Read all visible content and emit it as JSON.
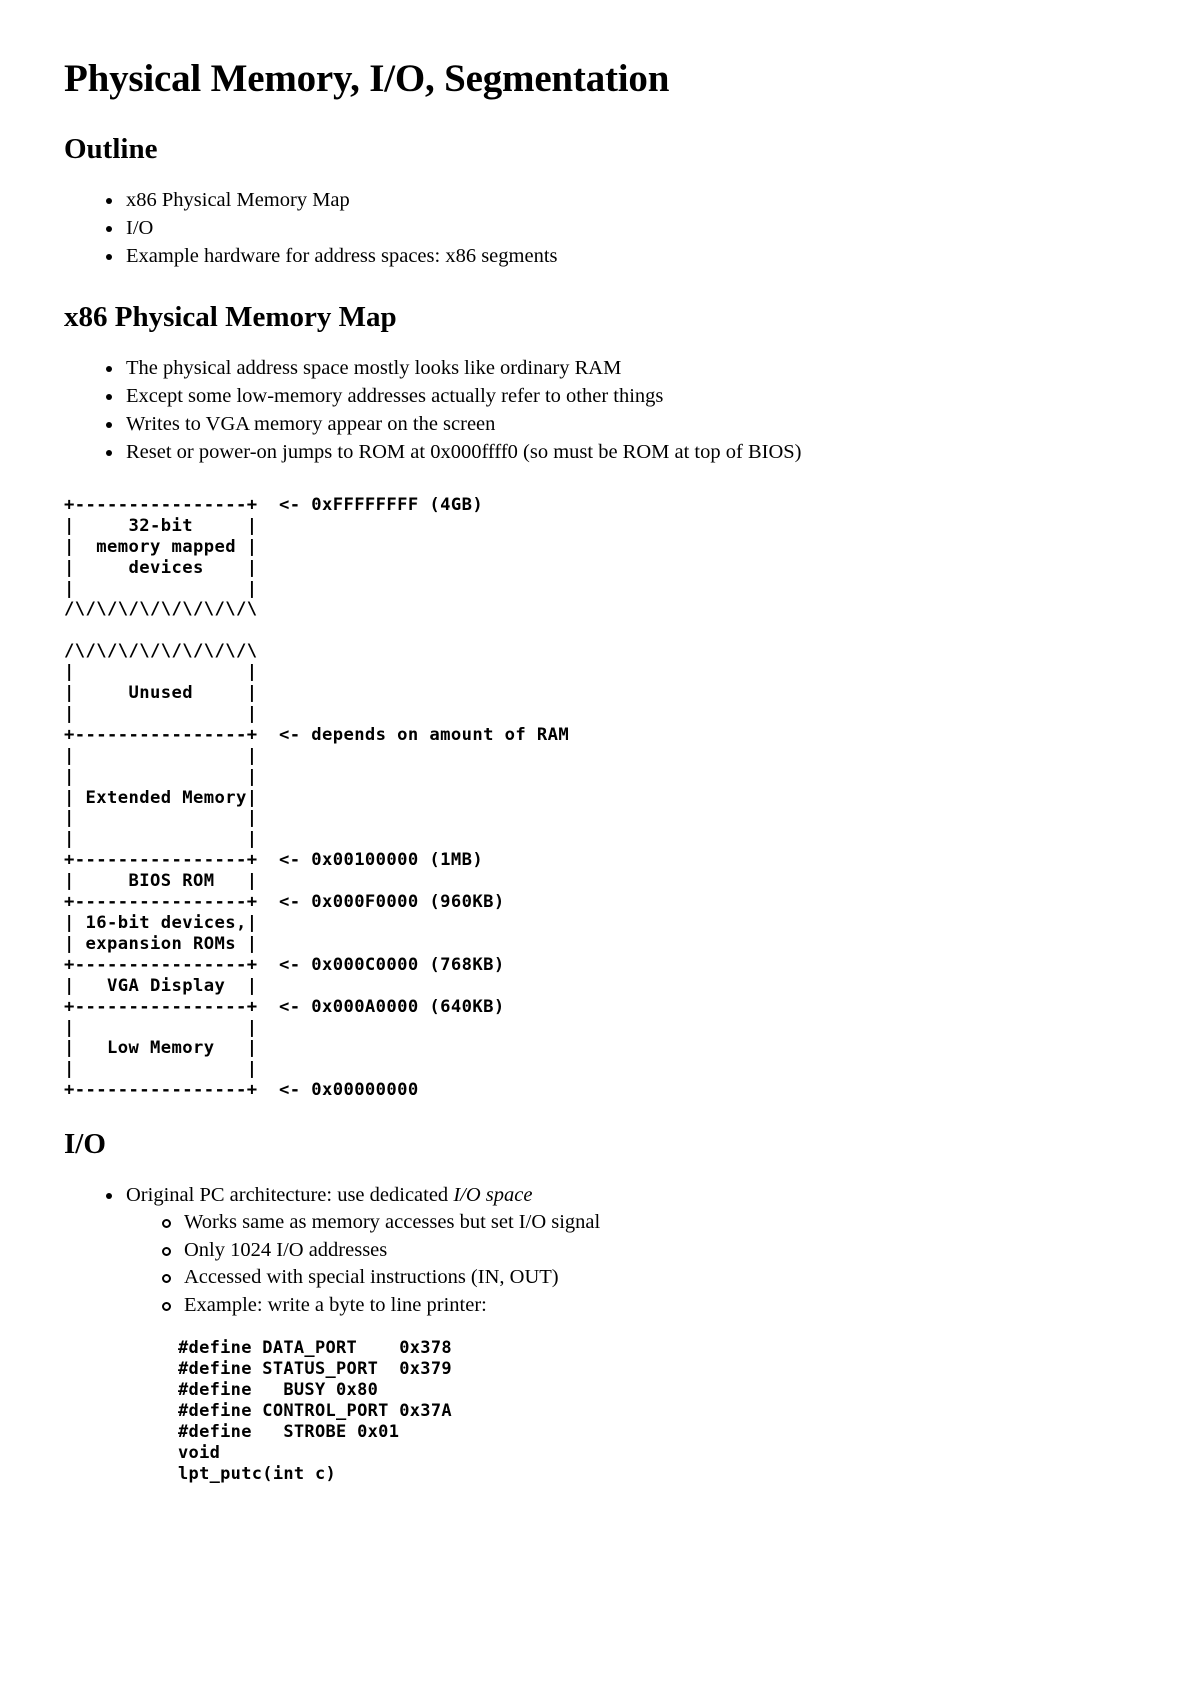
{
  "document": {
    "title": "Physical Memory, I/O, Segmentation"
  },
  "outline": {
    "heading": "Outline",
    "items": [
      "x86 Physical Memory Map",
      "I/O",
      "Example hardware for address spaces: x86 segments"
    ]
  },
  "memory_map": {
    "heading": "x86 Physical Memory Map",
    "items": [
      "The physical address space mostly looks like ordinary RAM",
      "Except some low-memory addresses actually refer to other things",
      "Writes to VGA memory appear on the screen",
      "Reset or power-on jumps to ROM at 0x000ffff0 (so must be ROM at top of BIOS)"
    ],
    "diagram": "+----------------+  <- 0xFFFFFFFF (4GB)\n|     32-bit     |\n|  memory mapped |\n|     devices    |\n|                |\n/\\/\\/\\/\\/\\/\\/\\/\\/\\\n\n/\\/\\/\\/\\/\\/\\/\\/\\/\\\n|                |\n|     Unused     |\n|                |\n+----------------+  <- depends on amount of RAM\n|                |\n|                |\n| Extended Memory|\n|                |\n|                |\n+----------------+  <- 0x00100000 (1MB)\n|     BIOS ROM   |\n+----------------+  <- 0x000F0000 (960KB)\n| 16-bit devices,|\n| expansion ROMs |\n+----------------+  <- 0x000C0000 (768KB)\n|   VGA Display  |\n+----------------+  <- 0x000A0000 (640KB)\n|                |\n|   Low Memory   |\n|                |\n+----------------+  <- 0x00000000"
  },
  "io": {
    "heading": "I/O",
    "bullet_prefix": "Original PC architecture: use dedicated ",
    "bullet_italic": "I/O space",
    "subitems": [
      "Works same as memory accesses but set I/O signal",
      "Only 1024 I/O addresses",
      "Accessed with special instructions (IN, OUT)",
      "Example: write a byte to line printer:"
    ],
    "code": "#define DATA_PORT    0x378\n#define STATUS_PORT  0x379\n#define   BUSY 0x80\n#define CONTROL_PORT 0x37A\n#define   STROBE 0x01\nvoid\nlpt_putc(int c)"
  }
}
